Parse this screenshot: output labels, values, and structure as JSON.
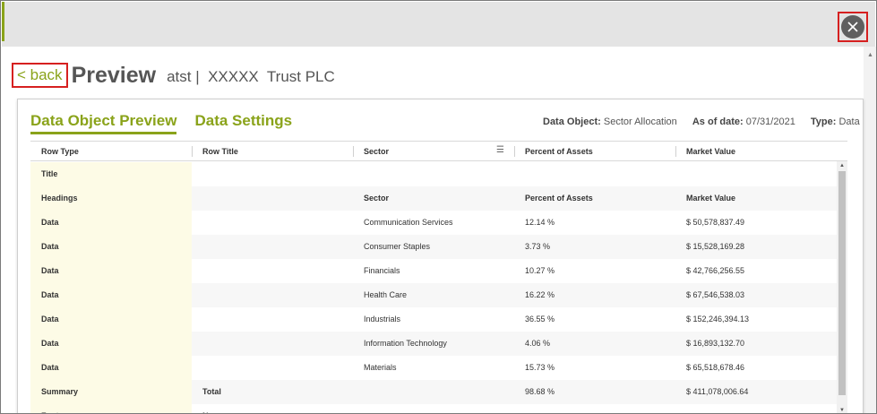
{
  "window": {
    "close_icon": "close-icon",
    "accent_color": "#8aa31a",
    "highlight_color": "#d62020"
  },
  "header": {
    "back_label": "< back",
    "title": "Preview",
    "subtitle": "atst |  XXXXX  Trust PLC"
  },
  "tabs": [
    {
      "label": "Data Object Preview",
      "active": true
    },
    {
      "label": "Data Settings",
      "active": false
    }
  ],
  "meta": {
    "data_object_label": "Data Object:",
    "data_object_value": "Sector Allocation",
    "as_of_label": "As of date:",
    "as_of_value": "07/31/2021",
    "type_label": "Type:",
    "type_value": "Data"
  },
  "grid": {
    "columns": [
      "Row Type",
      "Row Title",
      "Sector",
      "Percent of Assets",
      "Market Value"
    ],
    "rows": [
      [
        "Title",
        "",
        "",
        "",
        ""
      ],
      [
        "Headings",
        "",
        "Sector",
        "Percent of Assets",
        "Market Value"
      ],
      [
        "Data",
        "",
        "Communication Services",
        "12.14 %",
        "$ 50,578,837.49"
      ],
      [
        "Data",
        "",
        "Consumer Staples",
        "3.73 %",
        "$ 15,528,169.28"
      ],
      [
        "Data",
        "",
        "Financials",
        "10.27 %",
        "$ 42,766,256.55"
      ],
      [
        "Data",
        "",
        "Health Care",
        "16.22 %",
        "$ 67,546,538.03"
      ],
      [
        "Data",
        "",
        "Industrials",
        "36.55 %",
        "$ 152,246,394.13"
      ],
      [
        "Data",
        "",
        "Information Technology",
        "4.06 %",
        "$ 16,893,132.70"
      ],
      [
        "Data",
        "",
        "Materials",
        "15.73 %",
        "$ 65,518,678.46"
      ],
      [
        "Summary",
        "Total",
        "",
        "98.68 %",
        "$ 411,078,006.64"
      ],
      [
        "Footer",
        "Name",
        "",
        "",
        ""
      ]
    ]
  }
}
